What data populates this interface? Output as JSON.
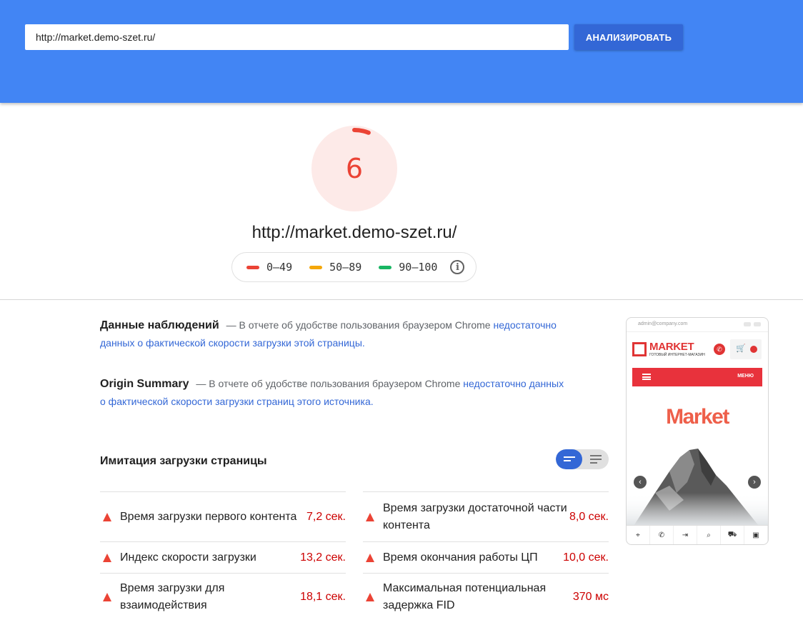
{
  "header": {
    "url_value": "http://market.demo-szet.ru/",
    "analyze_label": "АНАЛИЗИРОВАТЬ"
  },
  "score": {
    "value": "6",
    "fraction": 0.06,
    "color": "#eb4335",
    "bg_color": "#fdeae8"
  },
  "page_url": "http://market.demo-szet.ru/",
  "legend": [
    {
      "label": "0–49",
      "color": "#eb4335"
    },
    {
      "label": "50–89",
      "color": "#f4a70a"
    },
    {
      "label": "90–100",
      "color": "#18b663"
    }
  ],
  "field_data": {
    "title": "Данные наблюдений",
    "prefix": "— В отчете об удобстве пользования браузером Chrome",
    "link": "недостаточно данных о фактической скорости загрузки этой страницы."
  },
  "origin_summary": {
    "title": "Origin Summary",
    "prefix": "— В отчете об удобстве пользования браузером Chrome",
    "link": "недостаточно данных о фактической скорости загрузки страниц этого источника."
  },
  "lab": {
    "title": "Имитация загрузки страницы",
    "metrics_left": [
      {
        "name": "Время загрузки первого контента",
        "value": "7,2 сек."
      },
      {
        "name": "Индекс скорости загрузки",
        "value": "13,2 сек."
      },
      {
        "name": "Время загрузки для взаимодействия",
        "value": "18,1 сек."
      }
    ],
    "metrics_right": [
      {
        "name": "Время загрузки достаточной части контента",
        "value": "8,0 сек."
      },
      {
        "name": "Время окончания работы ЦП",
        "value": "10,0 сек."
      },
      {
        "name": "Максимальная потенциальная задержка FID",
        "value": "370 мс"
      }
    ]
  },
  "screenshot": {
    "email": "admin@company.com",
    "logo": "MARKET",
    "logo_sub": "ГОТОВЫЙ ИНТЕРНЕТ-МАГАЗИН",
    "menu": "МЕНЮ",
    "hero_title": "Market"
  },
  "icons": {
    "info": "info-icon",
    "prev": "chevron-left-icon",
    "next": "chevron-right-icon"
  }
}
